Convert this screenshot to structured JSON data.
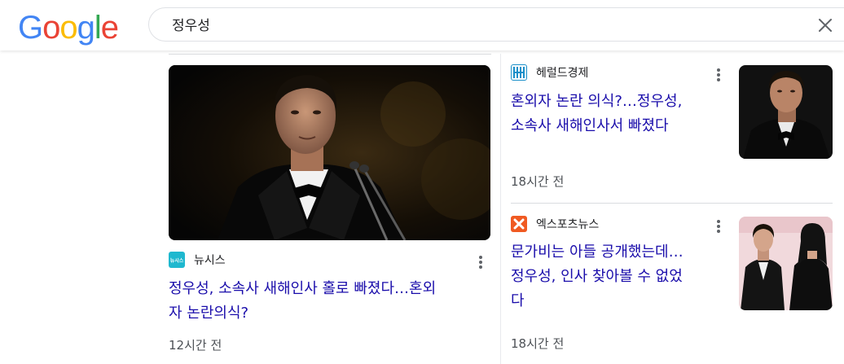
{
  "header": {
    "logo_letters": [
      {
        "ch": "G",
        "color": "#4285F4"
      },
      {
        "ch": "o",
        "color": "#EA4335"
      },
      {
        "ch": "o",
        "color": "#FBBC05"
      },
      {
        "ch": "g",
        "color": "#4285F4"
      },
      {
        "ch": "l",
        "color": "#34A853"
      },
      {
        "ch": "e",
        "color": "#EA4335"
      }
    ],
    "search_value": "정우성"
  },
  "cards": [
    {
      "source": "뉴시스",
      "source_logo_text": "뉴시스",
      "source_color": "#1fb8cf",
      "headline": "정우성, 소속사 새해인사 홀로 빠졌다…혼외자 논란의식?",
      "headline_lines": [
        "정우성, 소속사 새해인사 홀로 빠졌다…혼외",
        "자 논란의식?"
      ],
      "age": "12시간 전"
    },
    {
      "source": "헤럴드경제",
      "source_color": "#1a8fc9",
      "headline_lines": [
        "혼외자 논란 의식?…정우성,",
        "소속사 새해인사서 빠졌다"
      ],
      "age": "18시간 전"
    },
    {
      "source": "엑스포츠뉴스",
      "source_color": "#f05a22",
      "headline_lines": [
        "문가비는 아들 공개했는데…",
        "정우성, 인사 찾아볼 수 없었",
        "다"
      ],
      "age": "18시간 전"
    }
  ]
}
